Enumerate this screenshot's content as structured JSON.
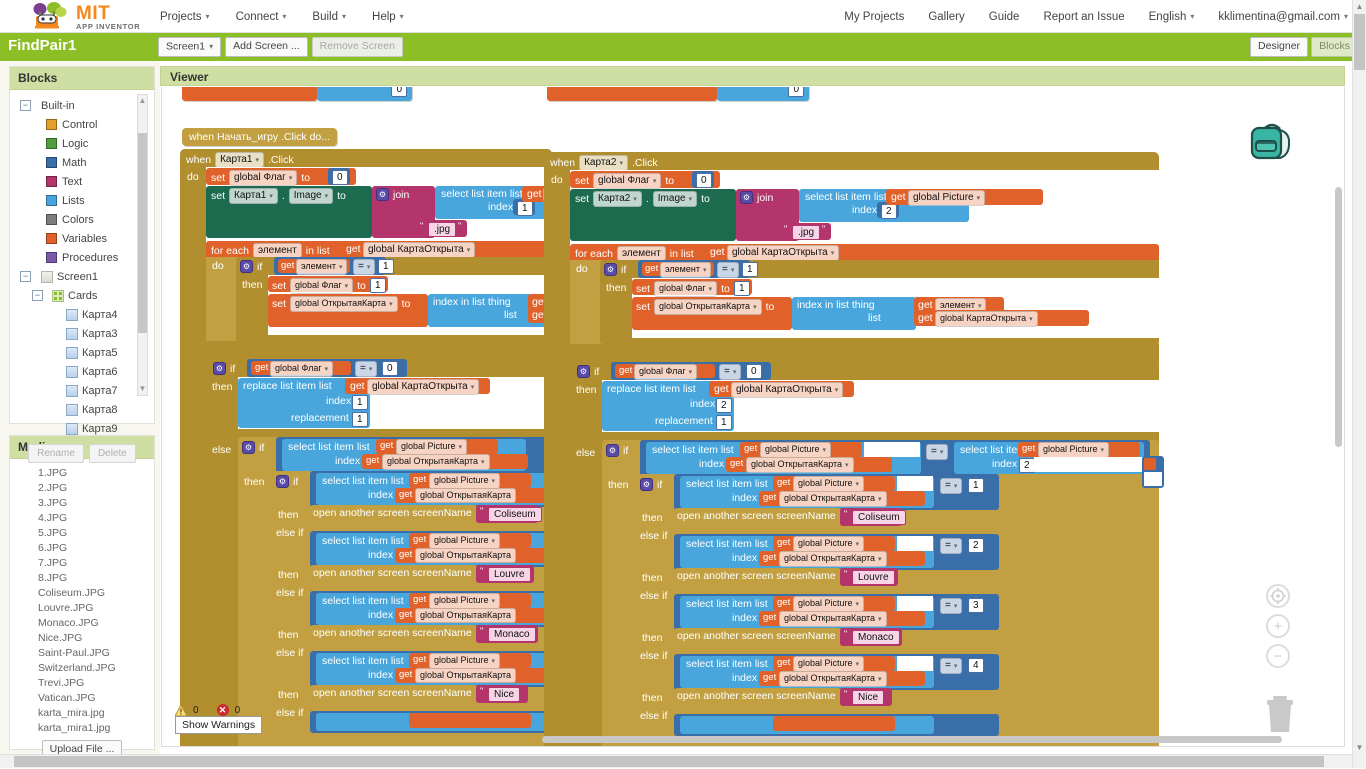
{
  "app": {
    "logo_title": "MIT",
    "logo_subtitle": "APP INVENTOR"
  },
  "topmenu": [
    {
      "label": "Projects",
      "has_caret": true
    },
    {
      "label": "Connect",
      "has_caret": true
    },
    {
      "label": "Build",
      "has_caret": true
    },
    {
      "label": "Help",
      "has_caret": true
    }
  ],
  "topright": [
    {
      "label": "My Projects",
      "has_caret": false
    },
    {
      "label": "Gallery",
      "has_caret": false
    },
    {
      "label": "Guide",
      "has_caret": false
    },
    {
      "label": "Report an Issue",
      "has_caret": false
    },
    {
      "label": "English",
      "has_caret": true
    },
    {
      "label": "kklimentina@gmail.com",
      "has_caret": true
    }
  ],
  "projectbar": {
    "project_name": "FindPair1",
    "screen_select": "Screen1",
    "add_screen": "Add Screen ...",
    "remove_screen": "Remove Screen",
    "designer": "Designer",
    "blocks": "Blocks"
  },
  "blocks_panel": {
    "title": "Blocks",
    "builtin_label": "Built-in",
    "builtin": [
      {
        "label": "Control",
        "color": "#e0a029"
      },
      {
        "label": "Logic",
        "color": "#4f9e3f"
      },
      {
        "label": "Math",
        "color": "#3a6ea8"
      },
      {
        "label": "Text",
        "color": "#b3356b"
      },
      {
        "label": "Lists",
        "color": "#49a6dc"
      },
      {
        "label": "Colors",
        "color": "#7d7d7d"
      },
      {
        "label": "Variables",
        "color": "#e0622a"
      },
      {
        "label": "Procedures",
        "color": "#7a5aa8"
      }
    ],
    "screen_label": "Screen1",
    "container_label": "Cards",
    "components": [
      "Карта4",
      "Карта3",
      "Карта5",
      "Карта6",
      "Карта7",
      "Карта8",
      "Карта9"
    ],
    "rename": "Rename",
    "delete": "Delete"
  },
  "media_panel": {
    "title": "Media",
    "files": [
      "1.JPG",
      "2.JPG",
      "3.JPG",
      "4.JPG",
      "5.JPG",
      "6.JPG",
      "7.JPG",
      "8.JPG",
      "Coliseum.JPG",
      "Louvre.JPG",
      "Monaco.JPG",
      "Nice.JPG",
      "Saint-Paul.JPG",
      "Switzerland.JPG",
      "Trevi.JPG",
      "Vatican.JPG",
      "karta_mira.jpg",
      "karta_mira1.jpg"
    ],
    "upload": "Upload File ..."
  },
  "viewer": {
    "title": "Viewer",
    "warning_count": "0",
    "error_count": "0",
    "show_warnings": "Show Warnings"
  },
  "icons": {
    "backpack": "backpack-icon",
    "center": "center-blocks-icon",
    "zoom_in": "+",
    "zoom_out": "−",
    "trash": "trash-icon"
  },
  "blocks": {
    "collapsed_event": "when Начать_игру .Click do...",
    "card1": {
      "when": "when",
      "component": "Карта1",
      "event": ".Click",
      "do": "do",
      "set_flag_label": "set",
      "global_flag": "global Флаг",
      "to": "to",
      "flag_value": "0",
      "set_image_set": "set",
      "set_image_component": "Карта1",
      "set_image_dot": ".",
      "set_image_prop": "Image",
      "set_image_to": "to",
      "join": "join",
      "select_list_item": "select list item  list",
      "get": "get",
      "global_picture": "global Picture",
      "index_label": "index",
      "index_value": "1",
      "jpg": ".jpg",
      "quote": "\"",
      "for_each": "for each",
      "loop_var": "элемент",
      "in_list": "in list",
      "global_kartaotkryta": "global КартаОткрыта",
      "do2": "do",
      "if": "if",
      "eq": "=",
      "one": "1",
      "then": "then",
      "set_flag_1": "1",
      "global_otkrytayakarta": "global ОткрытаяКарта",
      "index_in_list": "index in list  thing",
      "list_label": "list",
      "if2_flag_eq": "0",
      "replace_list_item": "replace list item  list",
      "replace_index": "1",
      "replacement_label": "replacement",
      "replacement_value": "1",
      "else": "else",
      "branches": [
        {
          "screen": "Coliseum"
        },
        {
          "screen": "Louvre"
        },
        {
          "screen": "Monaco"
        },
        {
          "screen": "Nice"
        }
      ],
      "open_screen": "open another screen  screenName",
      "else_if": "else if"
    },
    "card2": {
      "when": "when",
      "component": "Карта2",
      "event": ".Click",
      "do": "do",
      "set_flag_label": "set",
      "global_flag": "global Флаг",
      "to": "to",
      "flag_value": "0",
      "set_image_set": "set",
      "set_image_component": "Карта2",
      "set_image_dot": ".",
      "set_image_prop": "Image",
      "set_image_to": "to",
      "join": "join",
      "select_list_item": "select list item  list",
      "get": "get",
      "global_picture": "global Picture",
      "index_label": "index",
      "index_value": "2",
      "jpg": ".jpg",
      "quote": "\"",
      "for_each": "for each",
      "loop_var": "элемент",
      "in_list": "in list",
      "global_kartaotkryta": "global КартаОткрыта",
      "do2": "do",
      "if": "if",
      "eq": "=",
      "one": "1",
      "then": "then",
      "set_flag_1": "1",
      "global_otkrytayakarta": "global ОткрытаяКарта",
      "index_in_list": "index in list  thing",
      "list_label": "list",
      "if2_flag_eq": "0",
      "replace_list_item": "replace list item  list",
      "replace_index": "2",
      "replacement_label": "replacement",
      "replacement_value": "1",
      "else": "else",
      "compare_index": "2",
      "branches": [
        {
          "screen": "Coliseum",
          "value": "1"
        },
        {
          "screen": "Louvre",
          "value": "2"
        },
        {
          "screen": "Monaco",
          "value": "3"
        },
        {
          "screen": "Nice",
          "value": "4"
        }
      ],
      "open_screen": "open another screen  screenName",
      "else_if": "else if"
    },
    "top_stub": {
      "zero": "0"
    }
  }
}
